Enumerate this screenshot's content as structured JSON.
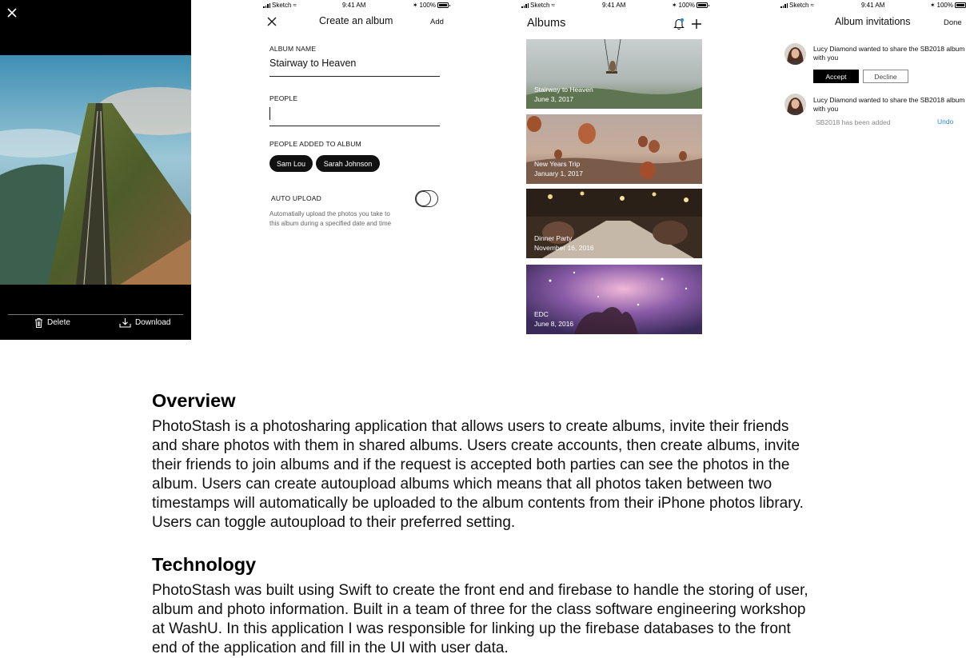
{
  "viewer": {
    "delete_label": "Delete",
    "download_label": "Download"
  },
  "statusbar": {
    "carrier": "Sketch",
    "time": "9:41 AM",
    "battery": "100%"
  },
  "create_album": {
    "title": "Create an album",
    "add_label": "Add",
    "album_name_label": "ALBUM NAME",
    "album_name_value": "Stairway to Heaven",
    "people_label": "PEOPLE",
    "people_added_label": "PEOPLE ADDED TO ALBUM",
    "people_added": [
      "Sam Lou",
      "Sarah Johnson"
    ],
    "auto_upload_label": "AUTO UPLOAD",
    "auto_upload_on": false,
    "auto_upload_help": "Automatially upload the photos you take to this album during a specified date and time"
  },
  "albums": {
    "title": "Albums",
    "items": [
      {
        "name": "Stairway to Heaven",
        "date": "June 3, 2017"
      },
      {
        "name": "New Years Trip",
        "date": "January 1, 2017"
      },
      {
        "name": "Dinner Party",
        "date": "November 16, 2016"
      },
      {
        "name": "EDC",
        "date": "June 8, 2016"
      }
    ]
  },
  "invitations": {
    "title": "Album invitations",
    "done_label": "Done",
    "items": [
      {
        "text": "Lucy Diamond wanted to share the SB2018 album with you"
      },
      {
        "text": "Lucy Diamond wanted to share the SB2018 album with you"
      }
    ],
    "accept_label": "Accept",
    "decline_label": "Decline",
    "added_note": "SB2018 has been added",
    "undo_label": "Undo",
    "link_color": "#2a8cd6"
  },
  "overview": {
    "heading": "Overview",
    "body": "PhotoStash is a photosharing application that allows users to create albums, invite their friends and share photos with them in shared albums. Users create accounts, then create albums, invite their friends to join albums and if the request is accepted both parties can see the photos in the album. Users can create autoupload albums which means that all photos taken between two timestamps will automatically be uploaded to the album contents from their iPhone photos library. Users can toggle autoupload to their preferred setting."
  },
  "technology": {
    "heading": "Technology",
    "body": "PhotoStash was built using Swift to create the front end and firebase to handle the storing of user, album and photo information. Built in a team of three for the class software engineering workshop at WashU. In this application I was responsible for linking up the firebase databases to the front end of the application and fill in the UI with user data."
  }
}
